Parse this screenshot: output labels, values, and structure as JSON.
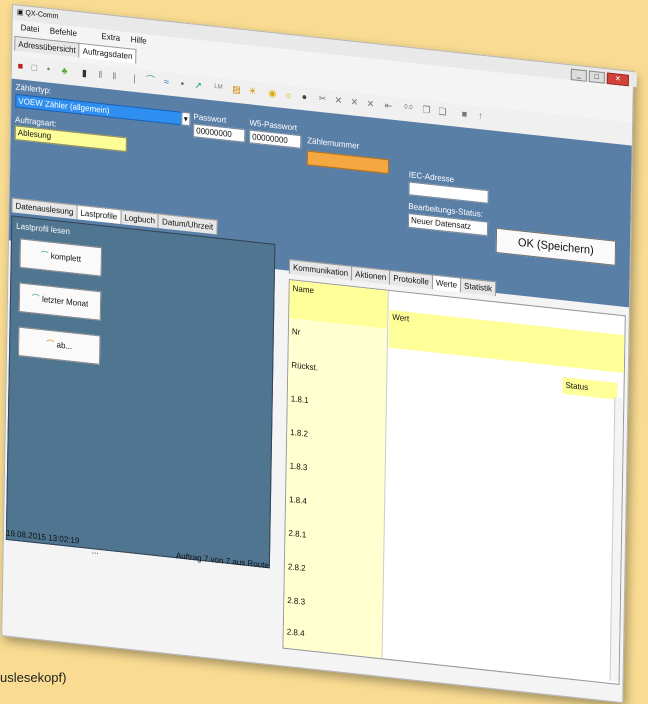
{
  "app": {
    "title": "QX-Comm"
  },
  "menu": {
    "file": "Datei",
    "commands": "Befehle",
    "extra": "Extra",
    "help": "Hilfe"
  },
  "top_tabs": {
    "overview": "Adressübersicht",
    "order": "Auftragsdaten"
  },
  "fields": {
    "zaehlertyp_label": "Zählertyp:",
    "zaehlertyp_value": "VOEW Zähler (allgemein)",
    "passwort_label": "Passwort",
    "passwort_value": "00000000",
    "w5_label": "W5-Passwort",
    "w5_value": "00000000",
    "zaehlernummer_label": "Zählernummer",
    "iec_label": "IEC-Adresse",
    "auftragsart_label": "Auftragsart:",
    "auftragsart_value": "Ablesung",
    "bearbeitung_label": "Bearbeitungs-Status:",
    "bearbeitung_value": "Neuer Datensatz",
    "ok_label": "OK  (Speichern)"
  },
  "sub_tabs": {
    "a": "Datenauslesung",
    "b": "Lastprofile",
    "c": "Logbuch",
    "d": "Datum/Uhrzeit"
  },
  "lastprofil": {
    "title": "Lastprofil lesen",
    "komplett": "komplett",
    "letzter": "letzter Monat",
    "ab": "ab..."
  },
  "right_tabs": {
    "a": "Kommunikation",
    "b": "Aktionen",
    "c": "Protokolle",
    "d": "Werte",
    "e": "Statistik"
  },
  "grid": {
    "name_header": "Name",
    "wert_header": "Wert",
    "status_header": "Status",
    "rows": [
      "Nr",
      "Rückst.",
      "1.8.1",
      "1.8.2",
      "1.8.3",
      "1.8.4",
      "2.8.1",
      "2.8.2",
      "2.8.3",
      "2.8.4"
    ]
  },
  "status": {
    "datetime": "19.08.2015   13:02:19",
    "dots": "...",
    "route": "Auftrag 7 von 7 aus Route"
  },
  "caption": "uslesekopf)",
  "colors": {
    "panel_blue": "#5a7fa7",
    "highlight_yellow": "#ffff99",
    "orange": "#f5a742",
    "combo_blue": "#2f8ff0"
  }
}
